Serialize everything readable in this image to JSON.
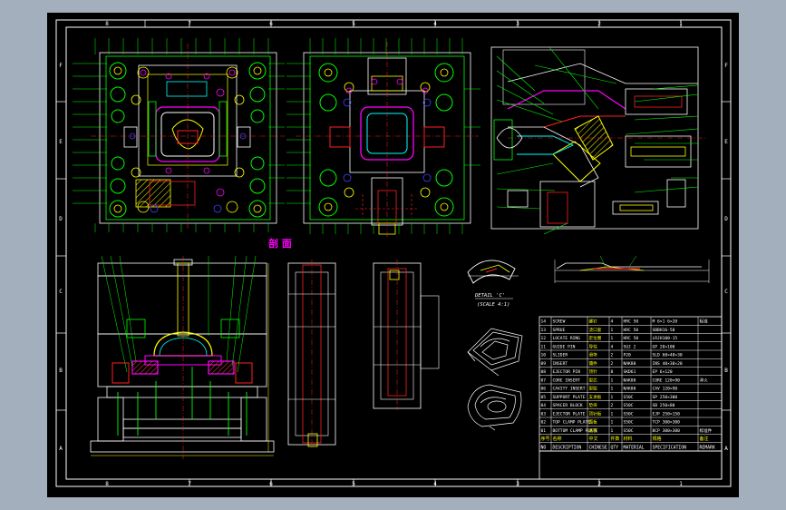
{
  "drawing": {
    "border_columns_top": [
      "8",
      "7",
      "6",
      "5",
      "4",
      "3",
      "2",
      "1"
    ],
    "border_columns_bottom": [
      "8",
      "7",
      "6",
      "5",
      "4",
      "3",
      "2",
      "1"
    ],
    "border_rows_left": [
      "F",
      "E",
      "D",
      "C",
      "B",
      "A"
    ],
    "border_rows_right": [
      "F",
      "E",
      "D",
      "C",
      "B",
      "A"
    ],
    "section_label": "剖 面",
    "detail_label": "DETAIL 'C'",
    "detail_scale": "(SCALE 4:1)"
  },
  "bom": {
    "columns": [
      "NO",
      "DESCRIPTION",
      "CHINESE",
      "QTY",
      "MATERIAL",
      "SPECIFICATION",
      "REMARK"
    ],
    "header_chinese": [
      "序号",
      "名称",
      "中文",
      "件数",
      "材料",
      "规格",
      "备注"
    ],
    "rows": [
      {
        "no": "14",
        "desc": "SCREW",
        "cn": "螺钉",
        "qty": "4",
        "mat": "HRC 50",
        "spec": "M 6×1 6×20",
        "remark": "标准"
      },
      {
        "no": "13",
        "desc": "SPRUE",
        "cn": "浇口套",
        "qty": "1",
        "mat": "HRC 50",
        "spec": "SBBH16-50",
        "remark": ""
      },
      {
        "no": "12",
        "desc": "LOCATE RING",
        "cn": "定位圈",
        "qty": "1",
        "mat": "HRC 50",
        "spec": "LRJH100-15",
        "remark": ""
      },
      {
        "no": "11",
        "desc": "GUIDE PIN",
        "cn": "导柱",
        "qty": "4",
        "mat": "SUJ 2",
        "spec": "GP 20×100",
        "remark": ""
      },
      {
        "no": "10",
        "desc": "SLIDER",
        "cn": "滑块",
        "qty": "2",
        "mat": "P20",
        "spec": "SLD 60×40×30",
        "remark": ""
      },
      {
        "no": "09",
        "desc": "INSERT",
        "cn": "镶件",
        "qty": "2",
        "mat": "NAK80",
        "spec": "INS 40×30×20",
        "remark": ""
      },
      {
        "no": "08",
        "desc": "EJECTOR PIN",
        "cn": "顶针",
        "qty": "8",
        "mat": "SKD61",
        "spec": "EP 6×120",
        "remark": ""
      },
      {
        "no": "07",
        "desc": "CORE INSERT",
        "cn": "型芯",
        "qty": "1",
        "mat": "NAK80",
        "spec": "CORE 120×90",
        "remark": "淬火"
      },
      {
        "no": "06",
        "desc": "CAVITY INSERT",
        "cn": "型腔",
        "qty": "1",
        "mat": "NAK80",
        "spec": "CAV 120×90",
        "remark": ""
      },
      {
        "no": "05",
        "desc": "SUPPORT PLATE",
        "cn": "支承板",
        "qty": "1",
        "mat": "S50C",
        "spec": "SP 250×300",
        "remark": ""
      },
      {
        "no": "04",
        "desc": "SPACER BLOCK",
        "cn": "垫块",
        "qty": "2",
        "mat": "S50C",
        "spec": "SB 250×80",
        "remark": ""
      },
      {
        "no": "03",
        "desc": "EJECTOR PLATE",
        "cn": "顶针板",
        "qty": "1",
        "mat": "S50C",
        "spec": "EJP 250×150",
        "remark": ""
      },
      {
        "no": "02",
        "desc": "TOP CLAMP PLATE",
        "cn": "面板",
        "qty": "1",
        "mat": "S50C",
        "spec": "TCP 300×300",
        "remark": ""
      },
      {
        "no": "01",
        "desc": "BOTTOM CLAMP PLATE",
        "cn": "底板",
        "qty": "1",
        "mat": "S50C",
        "spec": "BCP 300×300",
        "remark": "标准件"
      }
    ]
  },
  "colors": {
    "background": "#a3afbc",
    "sheet": "#000000",
    "frame": "#ffffff",
    "green": "#00ff00",
    "yellow": "#ffff00",
    "cyan": "#00ffff",
    "red": "#ff2020",
    "magenta": "#ff00ff",
    "blue": "#4040ff"
  }
}
